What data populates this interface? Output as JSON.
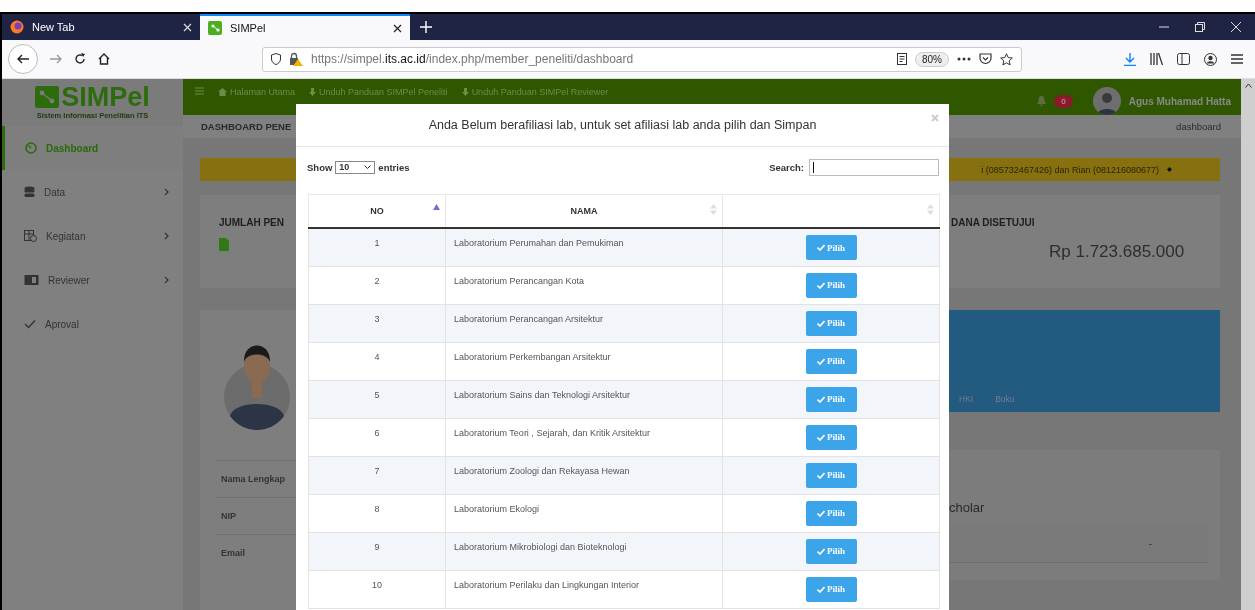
{
  "browser": {
    "tabs": [
      {
        "title": "New Tab",
        "selected": false
      },
      {
        "title": "SIMPel",
        "selected": true
      }
    ],
    "url": "https://simpel.**its.ac.id**/index.php/member_peneliti/dashboard",
    "zoom": "80%"
  },
  "app": {
    "logo_title": "SIMPel",
    "logo_subtitle": "Sistem Informasi Penelitian ITS",
    "nav_links": [
      "Halaman Utama",
      "Unduh Panduan SIMPel Peneliti",
      "Unduh Panduan SIMPel Reviewer"
    ],
    "notifications": "0",
    "user_name": "Agus Muhamad Hatta"
  },
  "sidebar": {
    "items": [
      {
        "label": "Dashboard",
        "selected": true,
        "has_submenu": false
      },
      {
        "label": "Data",
        "selected": false,
        "has_submenu": true
      },
      {
        "label": "Kegiatan",
        "selected": false,
        "has_submenu": true
      },
      {
        "label": "Reviewer",
        "selected": false,
        "has_submenu": true
      },
      {
        "label": "Aproval",
        "selected": false,
        "has_submenu": false
      }
    ]
  },
  "page": {
    "heading": "DASHBOARD PENE",
    "breadcrumb": "dashboard",
    "notice": "i (085732467426) dan Rian (081216080677)",
    "stat_left_title": "JUMLAH PEN",
    "stat_right_title": "DANA DISETUJUI",
    "stat_right_value": "Rp 1.723.685.000",
    "profile_fields": [
      "Nama Lengkap",
      "NIP",
      "Email"
    ],
    "profile_tabs": [
      "HKI",
      "Buku"
    ],
    "scholar_title": "cholar",
    "scholar_value": "-"
  },
  "modal": {
    "title": "Anda Belum berafiliasi lab, untuk set afiliasi lab anda pilih dan Simpan",
    "show_label": "Show",
    "page_size": "10",
    "entries_label": "entries",
    "search_label": "Search:",
    "columns": [
      {
        "label": "NO",
        "kind": "sorted"
      },
      {
        "label": "NAMA",
        "kind": "sortable"
      },
      {
        "kind": "sortable"
      }
    ],
    "rows": [
      {
        "no": "1",
        "nama": "Laboratorium Perumahan dan Pemukiman",
        "action": "Pilih"
      },
      {
        "no": "2",
        "nama": "Laboratorium Perancangan Kota",
        "action": "Pilih"
      },
      {
        "no": "3",
        "nama": "Laboratorium Perancangan Arsitektur",
        "action": "Pilih"
      },
      {
        "no": "4",
        "nama": "Laboratorium Perkembangan Arsitektur",
        "action": "Pilih"
      },
      {
        "no": "5",
        "nama": "Laboratorium Sains dan Teknologi Arsitektur",
        "action": "Pilih"
      },
      {
        "no": "6",
        "nama": "Laboratorium Teori , Sejarah, dan Kritik Arsitektur",
        "action": "Pilih"
      },
      {
        "no": "7",
        "nama": "Laboratorium Zoologi dan Rekayasa Hewan",
        "action": "Pilih"
      },
      {
        "no": "8",
        "nama": "Laboratorium Ekologi",
        "action": "Pilih"
      },
      {
        "no": "9",
        "nama": "Laboratorium Mikrobiologi dan Bioteknologi",
        "action": "Pilih"
      },
      {
        "no": "10",
        "nama": "Laboratorium Perilaku dan Lingkungan Interior",
        "action": "Pilih"
      }
    ]
  }
}
